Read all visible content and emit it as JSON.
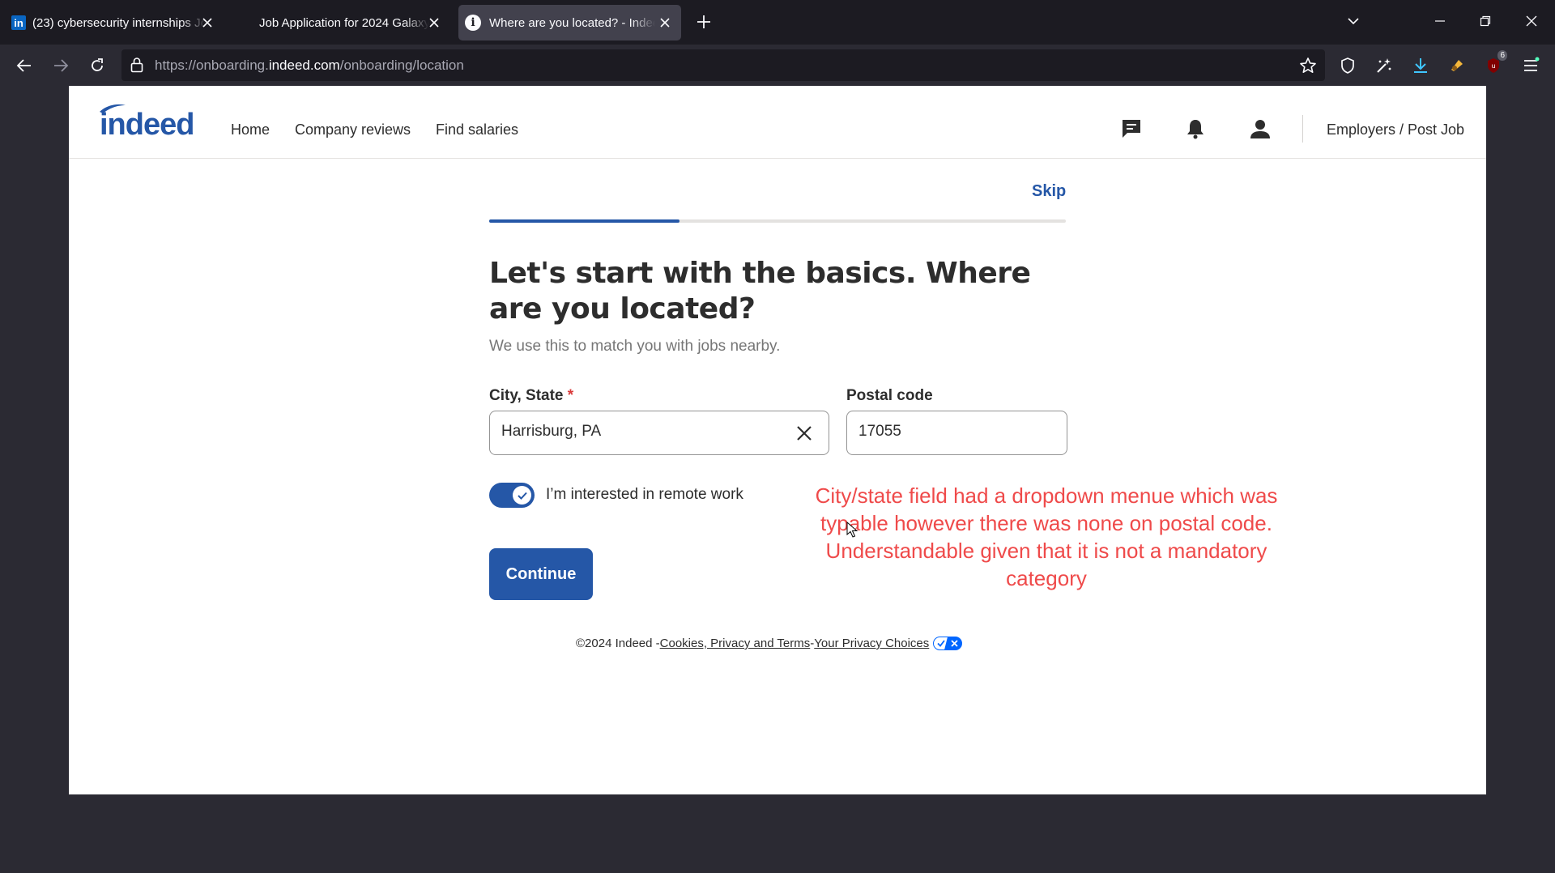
{
  "browser": {
    "tabs": [
      {
        "title": "(23) cybersecurity internships Jo",
        "favicon": "linkedin-icon",
        "active": false
      },
      {
        "title": "Job Application for 2024 Galaxy",
        "favicon": "",
        "active": false
      },
      {
        "title": "Where are you located? - Indeed",
        "favicon": "info-icon",
        "active": true
      }
    ],
    "url_prefix": "https://onboarding.",
    "url_host": "indeed.com",
    "url_path": "/onboarding/location",
    "extension_badge": "6"
  },
  "header": {
    "logo": "indeed",
    "nav": [
      "Home",
      "Company reviews",
      "Find salaries"
    ],
    "employers_link": "Employers / Post Job"
  },
  "onboarding": {
    "skip_label": "Skip",
    "progress": 0.33,
    "heading": "Let's start with the basics. Where are you located?",
    "subtext": "We use this to match you with jobs nearby.",
    "city_label": "City, State",
    "required_marker": "*",
    "city_value": "Harrisburg, PA",
    "postal_label": "Postal code",
    "postal_value": "17055",
    "remote_label": "I’m interested in remote work",
    "remote_enabled": true,
    "continue_label": "Continue"
  },
  "footer": {
    "copyright": "©2024 Indeed - ",
    "cookies_link": "Cookies, Privacy and Terms",
    "separator": " - ",
    "privacy_link": "Your Privacy Choices"
  },
  "annotation": "City/state field had a dropdown menue which was typable however there was none on postal code. Understandable given that it is not a mandatory category",
  "colors": {
    "brand_blue": "#2557a7",
    "annotation_red": "#ef4a4a",
    "chrome_dark": "#1c1b22"
  }
}
